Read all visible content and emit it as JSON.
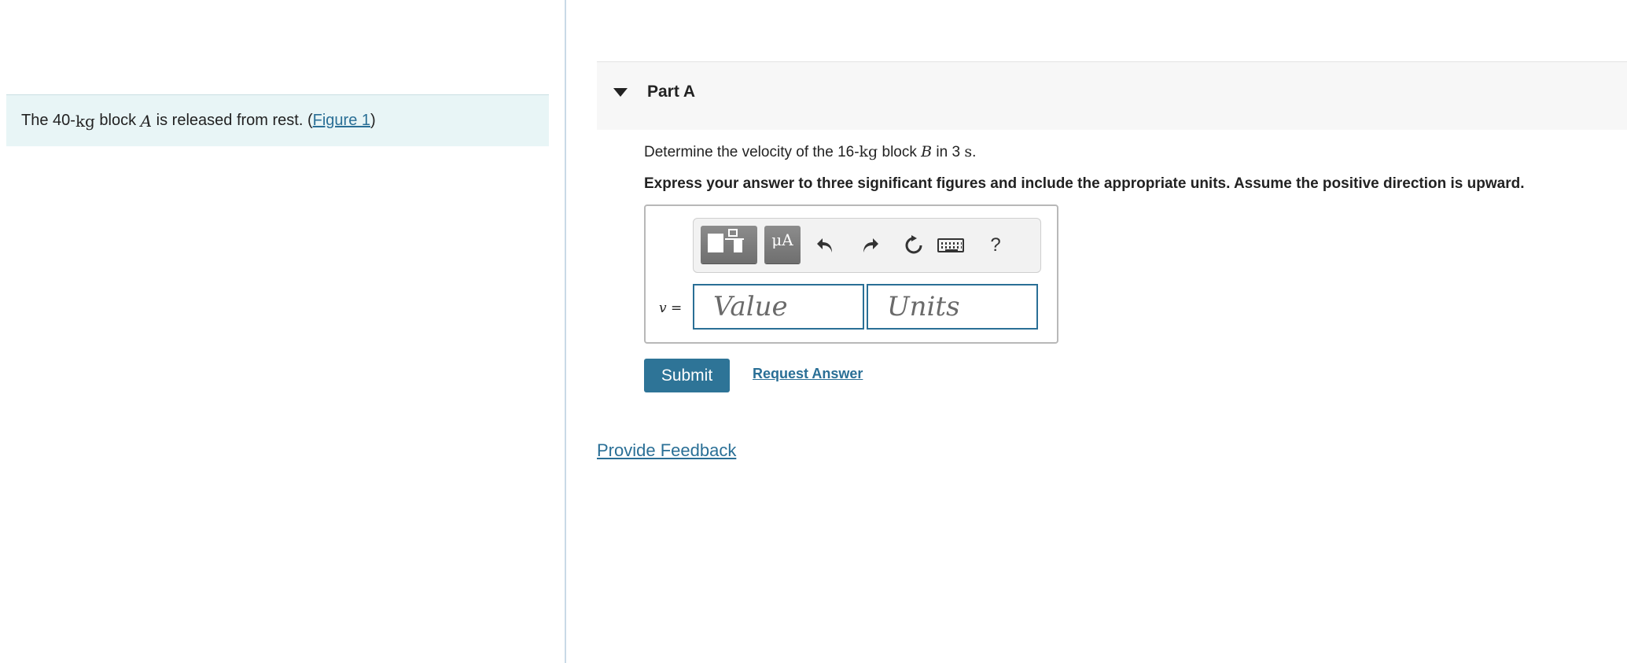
{
  "left_panel": {
    "intro": {
      "prefix": "The 40-",
      "mass_unit": "kg",
      "mid": " block ",
      "block_label": "A",
      "suffix": " is released from rest. (",
      "figure_link": "Figure 1",
      "close": ")"
    }
  },
  "part": {
    "title": "Part A",
    "question": {
      "prefix": "Determine the velocity of the 16-",
      "mass_unit": "kg",
      "mid": " block ",
      "block_label": "B",
      "time_prefix": " in 3 ",
      "time_unit": "s",
      "end": "."
    },
    "instruction": "Express your answer to three significant figures and include the appropriate units. Assume the positive direction is upward."
  },
  "toolbar": {
    "units_label": "μA",
    "help_label": "?",
    "icons": [
      "templates-icon",
      "units-icon",
      "undo-icon",
      "redo-icon",
      "reset-icon",
      "keyboard-icon",
      "help-icon"
    ]
  },
  "answer": {
    "variable_label": "v =",
    "value_placeholder": "Value",
    "units_placeholder": "Units"
  },
  "actions": {
    "submit_label": "Submit",
    "request_answer_label": "Request Answer",
    "feedback_label": "Provide Feedback"
  },
  "colors": {
    "accent": "#2e7497",
    "link": "#2a6f96",
    "intro_bg": "#e8f5f6"
  }
}
